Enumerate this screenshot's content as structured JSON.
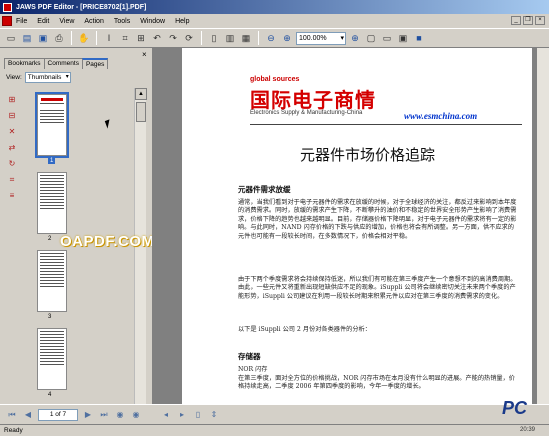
{
  "window": {
    "title": "JAWS PDF Editor - [PRICE8702[1].PDF]"
  },
  "menu": {
    "items": [
      "File",
      "Edit",
      "View",
      "Action",
      "Tools",
      "Window",
      "Help"
    ]
  },
  "toolbar": {
    "zoom": "100.00%"
  },
  "sidepanel": {
    "tabs": [
      "Bookmarks",
      "Comments",
      "Pages"
    ],
    "active_tab": "Pages",
    "view_label": "View:",
    "view_value": "Thumbnails",
    "thumbnails": [
      {
        "number": "1",
        "selected": true
      },
      {
        "number": "2",
        "selected": false
      },
      {
        "number": "3",
        "selected": false
      },
      {
        "number": "4",
        "selected": false
      }
    ]
  },
  "watermark": "OAPDF.COM",
  "document": {
    "logo_en": "global sources",
    "logo_cn": "国际电子商情",
    "logo_sub": "Electronics Supply & Manufacturing-China",
    "logo_url": "www.esmchina.com",
    "title": "元器件市场价格追踪",
    "section1_heading": "元器件需求放缓",
    "para1": "通常，当我们看到对于电子元器件的需求在放缓的时候，对于全球经济的关注，都反过来影响到本年度的消费需求。同时，放缓的需求产生下降，不断攀升的油价和不稳定的世界安全形势产生影响了消费需求，价格下降的趋势也越来越明显。目前，存储器价格下降明显，对于电子元器件的需求将有一定的影响。与此同时，NAND 闪存价格的下跌与供应的增加，价格也将会有所调整。另一方面，供不应求的元件也可能有一段较长时间，在多数情况下，价格会相对平稳。",
    "para2": "由于下两个季度需求将会持续保持低迷，所以我们有可能在第三季度产生一个意想不到的高消费周期。由此，一些元件又将重新出现短缺供应不足的现象。iSuppli 公司将会继续密切关注未来两个季度的产能形势，iSuppli 公司建议在利用一段较长时期来积累元件以应对在第三季度的消费需求的变化。",
    "para3": "以下是 iSuppli 公司 2 月份对各类器件的分析：",
    "section2_heading": "存储器",
    "subheading": "NOR 闪存",
    "para4": "在第三季度，面对全方位的价格挑战，NOR 闪存市场在本月没有什么明显的进展。产能的热销量，价格持续走高，二季度 2006 年第四季度的影响，今年一季度的增长。"
  },
  "navigation": {
    "page_box": "1 of 7"
  },
  "status": {
    "text": "Ready",
    "time": "20:39"
  }
}
